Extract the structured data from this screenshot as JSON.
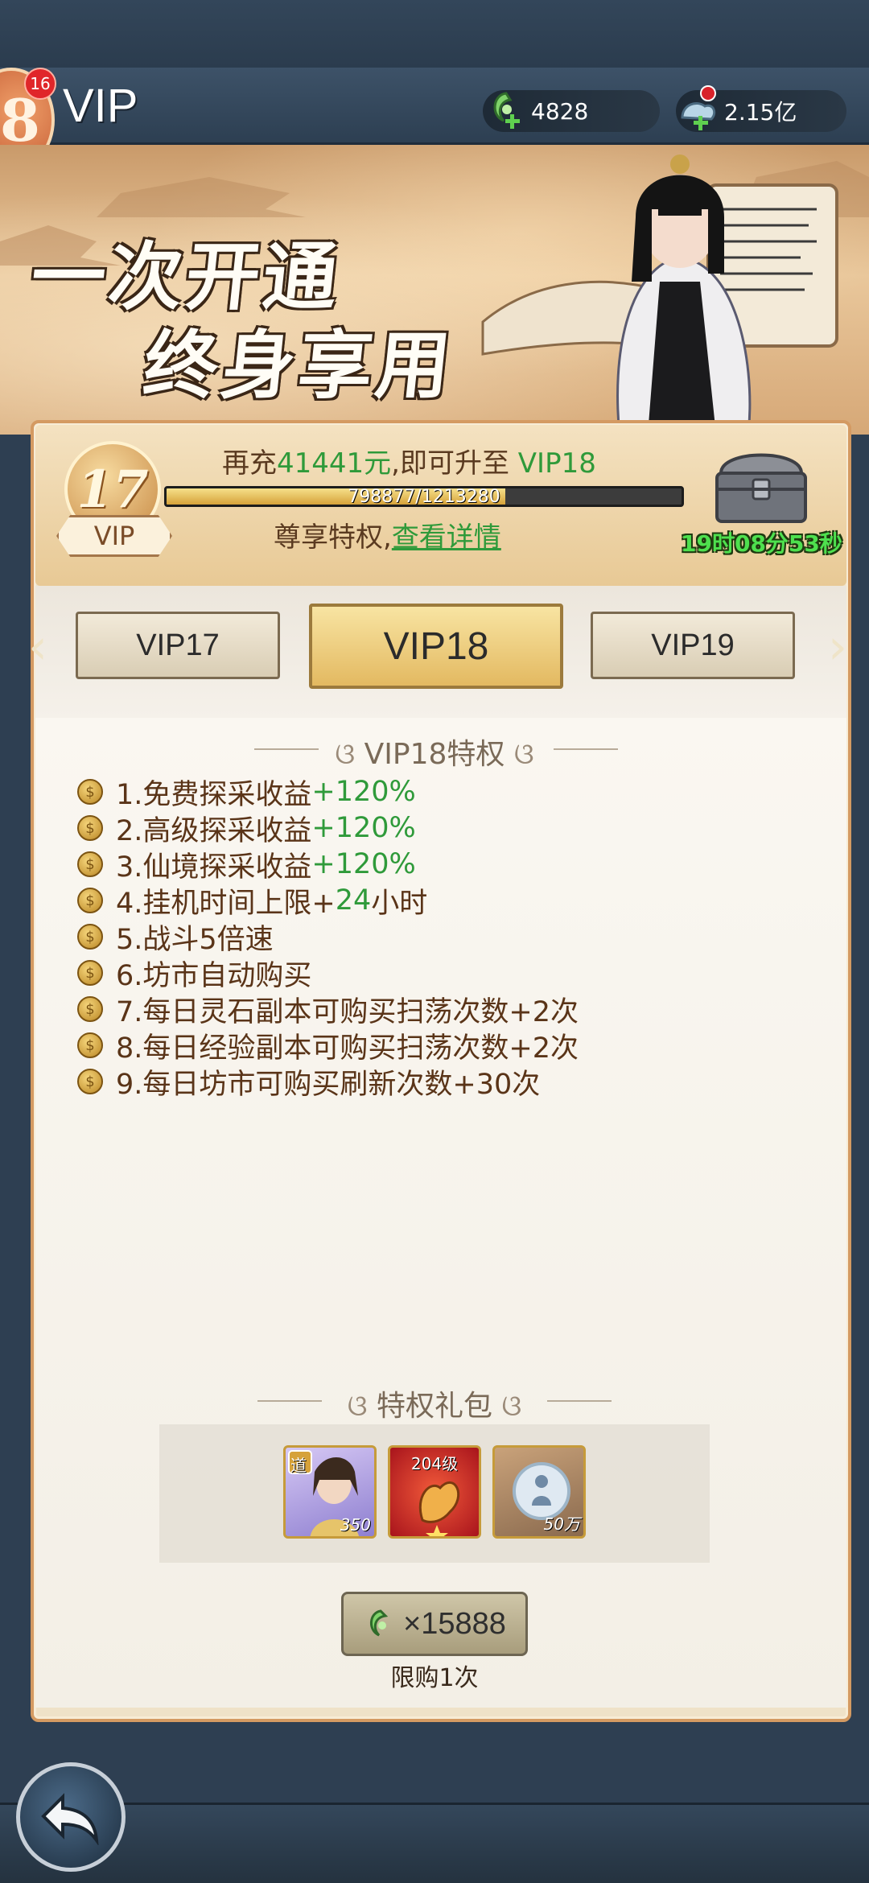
{
  "header": {
    "level_digit": "8",
    "notification_count": "16",
    "title": "VIP",
    "currency_jade": "4828",
    "currency_spirit": "2.15亿"
  },
  "banner": {
    "line1": "一次开通",
    "line2": "终身享用"
  },
  "vip_status": {
    "current_level": "17",
    "badge_label": "VIP",
    "recharge_prefix": "再充",
    "recharge_amount": "41441元",
    "recharge_middle": ",即可升至",
    "next_level": "VIP18",
    "progress_text": "798877/1213280",
    "progress_fraction": 0.6584,
    "privilege_prefix": "尊享特权,",
    "privilege_link": "查看详情",
    "countdown": "19时08分53秒"
  },
  "tabs": [
    {
      "label": "VIP17"
    },
    {
      "label": "VIP18"
    },
    {
      "label": "VIP19"
    }
  ],
  "privileges": {
    "title": "VIP18特权",
    "items": [
      {
        "text": "1.免费探采收益",
        "bonus": "+120%",
        "suffix": ""
      },
      {
        "text": "2.高级探采收益",
        "bonus": "+120%",
        "suffix": ""
      },
      {
        "text": "3.仙境探采收益",
        "bonus": "+120%",
        "suffix": ""
      },
      {
        "text": "4.挂机时间上限+",
        "bonus": "24",
        "suffix": "小时"
      },
      {
        "text": "5.战斗5倍速",
        "bonus": "",
        "suffix": ""
      },
      {
        "text": "6.坊市自动购买",
        "bonus": "",
        "suffix": ""
      },
      {
        "text": "7.每日灵石副本可购买扫荡次数+2次",
        "bonus": "",
        "suffix": ""
      },
      {
        "text": "8.每日经验副本可购买扫荡次数+2次",
        "bonus": "",
        "suffix": ""
      },
      {
        "text": "9.每日坊市可购买刷新次数+30次",
        "bonus": "",
        "suffix": ""
      }
    ]
  },
  "gift_pack": {
    "title": "特权礼包",
    "items": [
      {
        "badge": "道",
        "count": "350",
        "icon": "hero-card-icon"
      },
      {
        "top_label": "204级",
        "icon": "red-artifact-icon"
      },
      {
        "count": "50万",
        "icon": "spirit-orb-icon"
      }
    ],
    "price": "×15888",
    "limit": "限购1次"
  },
  "colors": {
    "accent_green": "#2f9a3a",
    "panel_border": "#d49a62",
    "topbar": "#3d5268"
  }
}
